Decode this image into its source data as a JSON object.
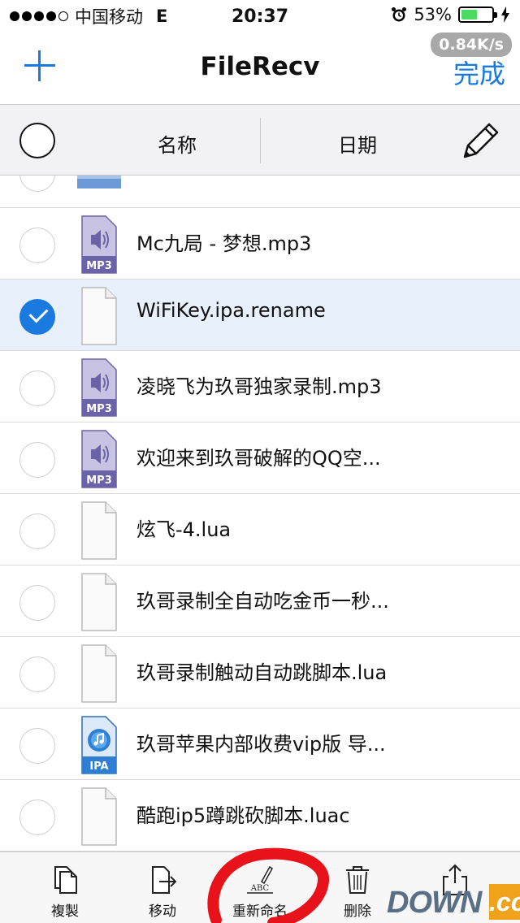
{
  "status_bar": {
    "carrier": "中国移动",
    "network": "E",
    "time": "20:37",
    "battery_percent": "53%",
    "battery_level": 0.53
  },
  "nav": {
    "title": "FileRecv",
    "speed": "0.84K/s",
    "done_label": "完成",
    "add_icon": "plus-icon"
  },
  "sort_header": {
    "name_label": "名称",
    "date_label": "日期",
    "edit_icon": "pencil-icon"
  },
  "files": [
    {
      "name": "Mc九局 - 梦想.mp3",
      "type": "mp3",
      "selected": false
    },
    {
      "name": "WiFiKey.ipa.rename",
      "type": "doc",
      "selected": true
    },
    {
      "name": "凌晓飞为玖哥独家录制.mp3",
      "type": "mp3",
      "selected": false
    },
    {
      "name": "欢迎来到玖哥破解的QQ空...",
      "type": "mp3",
      "selected": false
    },
    {
      "name": "炫飞-4.lua",
      "type": "doc",
      "selected": false
    },
    {
      "name": "玖哥录制全自动吃金币一秒...",
      "type": "doc",
      "selected": false
    },
    {
      "name": "玖哥录制触动自动跳脚本.lua",
      "type": "doc",
      "selected": false
    },
    {
      "name": "玖哥苹果内部收费vip版  导...",
      "type": "ipa",
      "selected": false
    },
    {
      "name": "酷跑ip5蹲跳砍脚本.luac",
      "type": "doc",
      "selected": false
    }
  ],
  "file_type_labels": {
    "mp3": "MP3",
    "ipa": "IPA"
  },
  "toolbar": {
    "copy_label": "複製",
    "move_label": "移动",
    "rename_label": "重新命名",
    "rename_icon_text": "ABC",
    "delete_label": "删除"
  },
  "watermark": {
    "text": "DOWN",
    "suffix": ".cc"
  },
  "colors": {
    "accent": "#1a7ae0",
    "selected_row": "#e8f0fb",
    "annotation": "#e8131a"
  }
}
